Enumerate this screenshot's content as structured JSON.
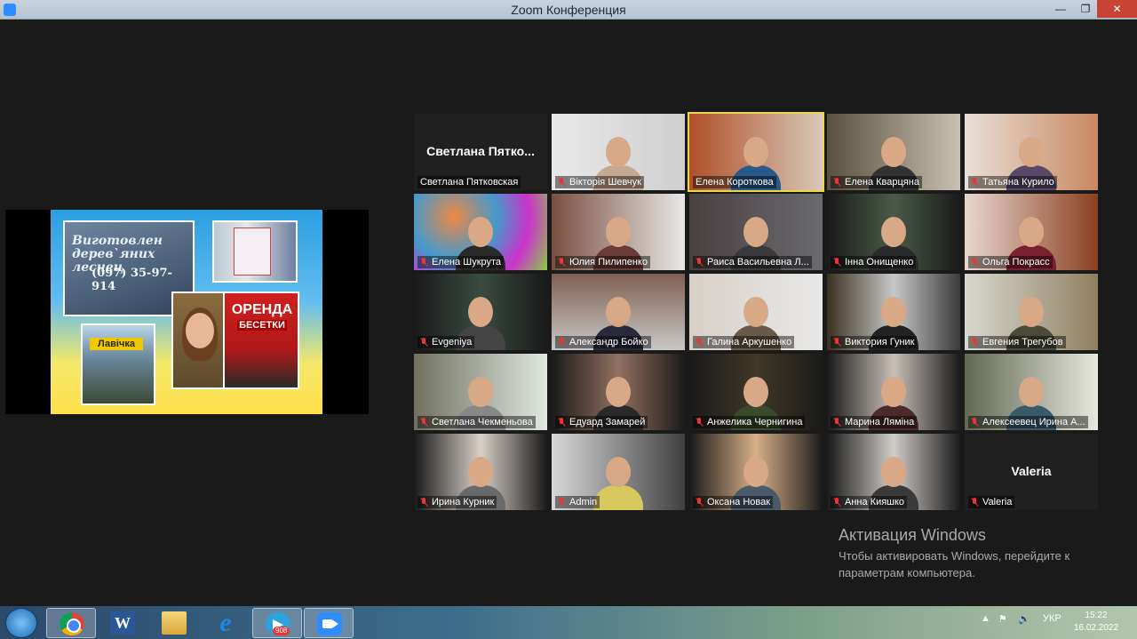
{
  "window": {
    "title": "Zoom Конференция",
    "minimize_icon": "minimize-icon",
    "restore_icon": "restore-icon",
    "close_icon": "close-icon"
  },
  "shared_screen": {
    "poster_text_1": "Виготовлен дерев`яних леснец",
    "poster_phone": "(097) 35-97-914",
    "poster_rent": "ОРЕНДА",
    "poster_rent_sub": "БЕСЕТКИ",
    "poster_shop": "Лавічка"
  },
  "participants": [
    {
      "name": "Светлана Пятковская",
      "display": "Светлана Пятко...",
      "video": false,
      "muted": false
    },
    {
      "name": "Вікторія Шевчук",
      "muted": true
    },
    {
      "name": "Елена Короткова",
      "muted": false,
      "active": true
    },
    {
      "name": "Елена Кварцяна",
      "muted": true
    },
    {
      "name": "Татьяна Курило",
      "muted": true
    },
    {
      "name": "Елена Шукрута",
      "muted": true
    },
    {
      "name": "Юлия Пилипенко",
      "muted": true
    },
    {
      "name": "Раиса Васильевна Л...",
      "muted": true
    },
    {
      "name": "Інна Онищенко",
      "muted": true
    },
    {
      "name": "Ольга Покрасс",
      "muted": true
    },
    {
      "name": "Evgeniya",
      "muted": true
    },
    {
      "name": "Александр Бойко",
      "muted": true
    },
    {
      "name": "Галина Аркушенко",
      "muted": true
    },
    {
      "name": "Виктория Гуник",
      "muted": true
    },
    {
      "name": "Евгения Трегубов",
      "muted": true
    },
    {
      "name": "Светлана Чекменьова",
      "muted": true
    },
    {
      "name": "Едуард Замарей",
      "muted": true
    },
    {
      "name": "Анжелика Чернигина",
      "muted": true
    },
    {
      "name": "Марина Ляміна",
      "muted": true
    },
    {
      "name": "Алексеевец Ирина А...",
      "muted": true
    },
    {
      "name": "Ирина Курник",
      "muted": true
    },
    {
      "name": "Admin",
      "muted": true
    },
    {
      "name": "Оксана Новак",
      "muted": true
    },
    {
      "name": "Анна Кияшко",
      "muted": true
    },
    {
      "name": "Valeria",
      "display": "Valeria",
      "video": false,
      "muted": true
    }
  ],
  "watermark": {
    "title": "Активация Windows",
    "line1": "Чтобы активировать Windows, перейдите к",
    "line2": "параметрам компьютера."
  },
  "taskbar": {
    "apps": [
      "windows-start-icon",
      "chrome-icon",
      "word-icon",
      "explorer-folder-icon",
      "internet-explorer-icon",
      "telegram-icon",
      "zoom-icon"
    ],
    "word_label": "W",
    "ie_label": "e",
    "telegram_badge": "908",
    "tray_arrow": "▲",
    "tray_flag": "⚑",
    "tray_volume": "🔈",
    "language": "УКР",
    "time": "15:22",
    "date": "16.02.2022"
  }
}
